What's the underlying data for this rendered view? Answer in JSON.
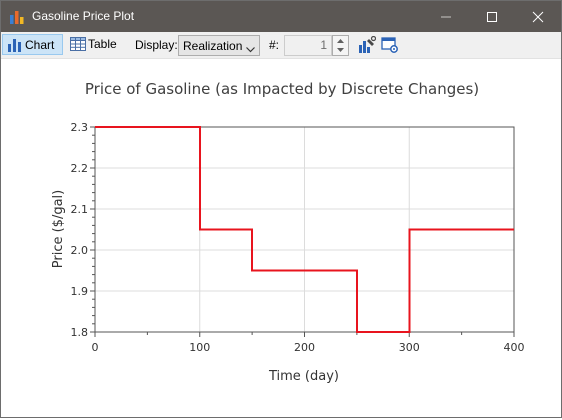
{
  "window": {
    "title": "Gasoline Price Plot",
    "icons": {
      "app": "bar-chart-icon",
      "minimize": "minimize-icon",
      "maximize": "maximize-icon",
      "close": "close-icon"
    }
  },
  "toolbar": {
    "chart_label": "Chart",
    "table_label": "Table",
    "display_label": "Display:",
    "display_value": "Realization",
    "number_label": "#:",
    "number_value": "1",
    "icons": [
      "chart-properties-icon",
      "window-settings-icon"
    ]
  },
  "colors": {
    "series": "#e8141e",
    "titlebar": "#5b5754",
    "active_tab": "#cce4f7"
  },
  "chart_data": {
    "type": "line",
    "step": true,
    "title": "Price of Gasoline (as Impacted by Discrete Changes)",
    "xlabel": "Time (day)",
    "ylabel": "Price ($/gal)",
    "xlim": [
      0,
      400
    ],
    "ylim": [
      1.8,
      2.3
    ],
    "xticks": [
      "0",
      "100",
      "200",
      "300",
      "400"
    ],
    "yticks": [
      "1.8",
      "1.9",
      "2.0",
      "2.1",
      "2.2",
      "2.3"
    ],
    "grid": true,
    "series": [
      {
        "x": [
          0,
          100,
          150,
          250,
          300,
          400
        ],
        "y": [
          2.3,
          2.05,
          1.95,
          1.8,
          2.05,
          2.05
        ]
      }
    ]
  }
}
